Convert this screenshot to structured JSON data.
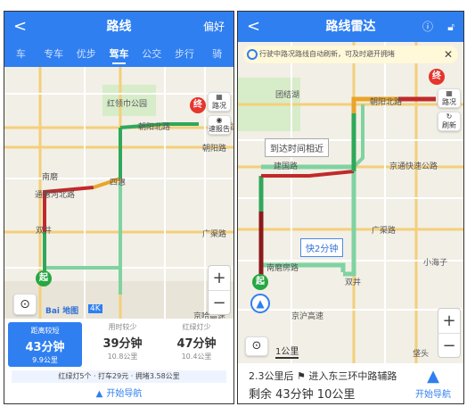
{
  "left": {
    "title": "路线",
    "back": "<",
    "prefs": "偏好",
    "tabs": [
      "车",
      "专车",
      "优步",
      "驾车",
      "公交",
      "步行",
      "骑"
    ],
    "active_tab": 3,
    "map_labels": {
      "park": "红领巾公园",
      "chaoyang_north": "朝阳北路",
      "chaoyang_road": "朝阳路",
      "nanmo": "南磨",
      "sihui": "四惠",
      "tonghui": "通惠河北路",
      "guangqu": "广渠路",
      "shuangjing": "双井",
      "jingsheng": "京哈高速",
      "cheng": "成"
    },
    "ctrl_traffic": "路况",
    "ctrl_report": "速报告",
    "zoom_in": "+",
    "zoom_out": "−",
    "start_pin": "起",
    "end_pin": "终",
    "baidu_logo": "Bai 地图",
    "badge_4k": "4K",
    "routes": [
      {
        "tag": "距离较短",
        "time": "43分钟",
        "dist": "9.9公里"
      },
      {
        "tag": "用时较少",
        "time": "39分钟",
        "dist": "10.8公里"
      },
      {
        "tag": "红绿灯少",
        "time": "47分钟",
        "dist": "10.4公里"
      }
    ],
    "info": "红绿灯5个 · 打车29元 · 拥堵3.58公里",
    "nav_label": "开始导航"
  },
  "right": {
    "title": "路线雷达",
    "back": "<",
    "banner": "行驶中路况路线自动刷新，可及时避开拥堵",
    "banner_close": "✕",
    "map_labels": {
      "tuanjiehu": "团结湖",
      "chaoyang_north": "朝阳北路",
      "jianguo": "建国路",
      "jingtong": "京通快速公路",
      "guangqu": "广渠路",
      "nanmo": "南磨房路",
      "xiaohaizi": "小海子",
      "shuangjing": "双井",
      "wangqiu": "垡头",
      "jingjin": "京沪高速"
    },
    "callout_similar": "到达时间相近",
    "callout_faster": "快2分钟",
    "ctrl_traffic": "路况",
    "ctrl_refresh": "刷新",
    "start_pin": "起",
    "end_pin": "终",
    "scale": "1公里",
    "zoom_in": "+",
    "zoom_out": "−",
    "next_turn": "2.3公里后",
    "next_road": "进入东三环中路辅路",
    "remain": "剩余 43分钟  10公里",
    "nav_label": "开始导航"
  }
}
